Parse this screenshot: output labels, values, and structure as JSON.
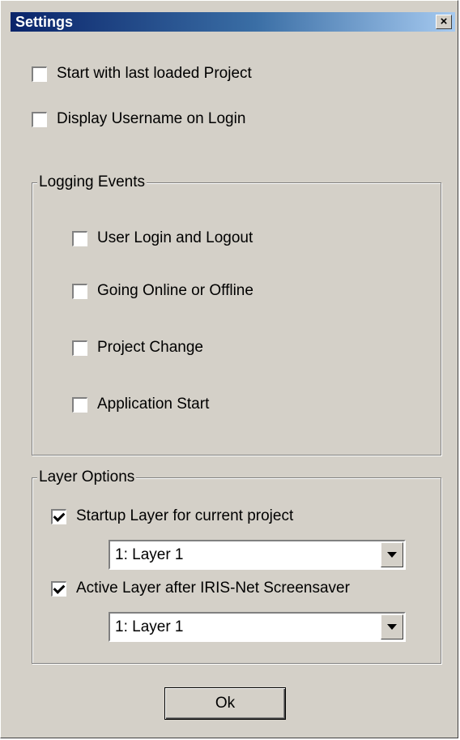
{
  "window": {
    "title": "Settings",
    "close_glyph": "×"
  },
  "general": {
    "start_last_project": {
      "label": "Start with last loaded Project",
      "checked": false
    },
    "display_username": {
      "label": "Display Username on Login",
      "checked": false
    }
  },
  "logging": {
    "title": "Logging Events",
    "items": [
      {
        "label": "User Login and Logout",
        "checked": false
      },
      {
        "label": "Going Online or Offline",
        "checked": false
      },
      {
        "label": "Project Change",
        "checked": false
      },
      {
        "label": "Application Start",
        "checked": false
      }
    ]
  },
  "layer_options": {
    "title": "Layer Options",
    "startup_layer": {
      "label": "Startup Layer for current project",
      "checked": true,
      "value": "1: Layer 1"
    },
    "active_layer": {
      "label": "Active Layer after IRIS-Net Screensaver",
      "checked": true,
      "value": "1: Layer 1"
    }
  },
  "buttons": {
    "ok_label": "Ok"
  },
  "icons": {
    "close": "close-icon",
    "dropdown": "chevron-down-icon",
    "check": "checkmark-icon"
  }
}
